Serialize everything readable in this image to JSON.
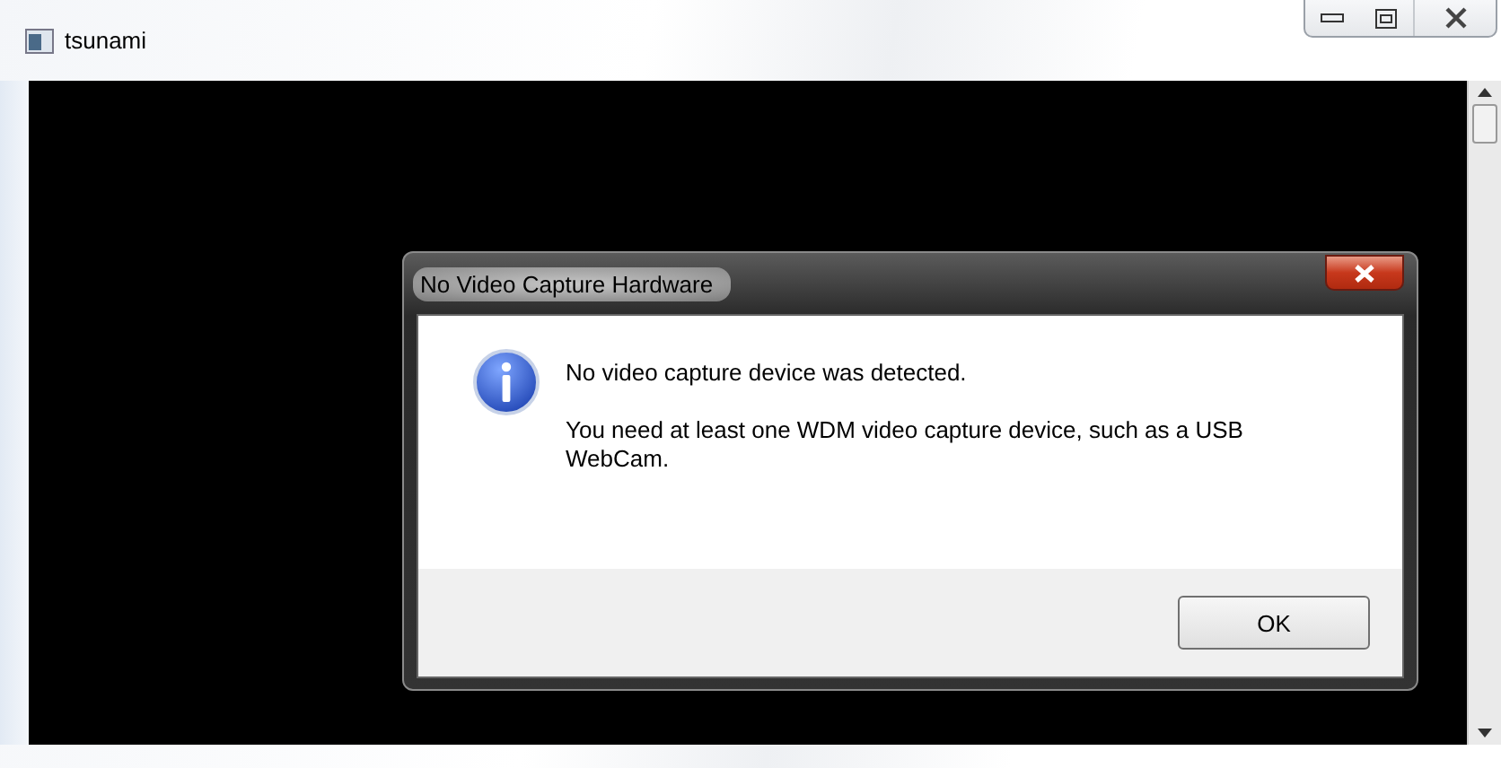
{
  "window": {
    "title": "tsunami"
  },
  "dialog": {
    "title": "No Video Capture Hardware",
    "message": "No video capture device was detected.",
    "detail": "You need at least one WDM video capture device, such as a USB WebCam.",
    "buttons": [
      {
        "label": "OK"
      }
    ]
  }
}
